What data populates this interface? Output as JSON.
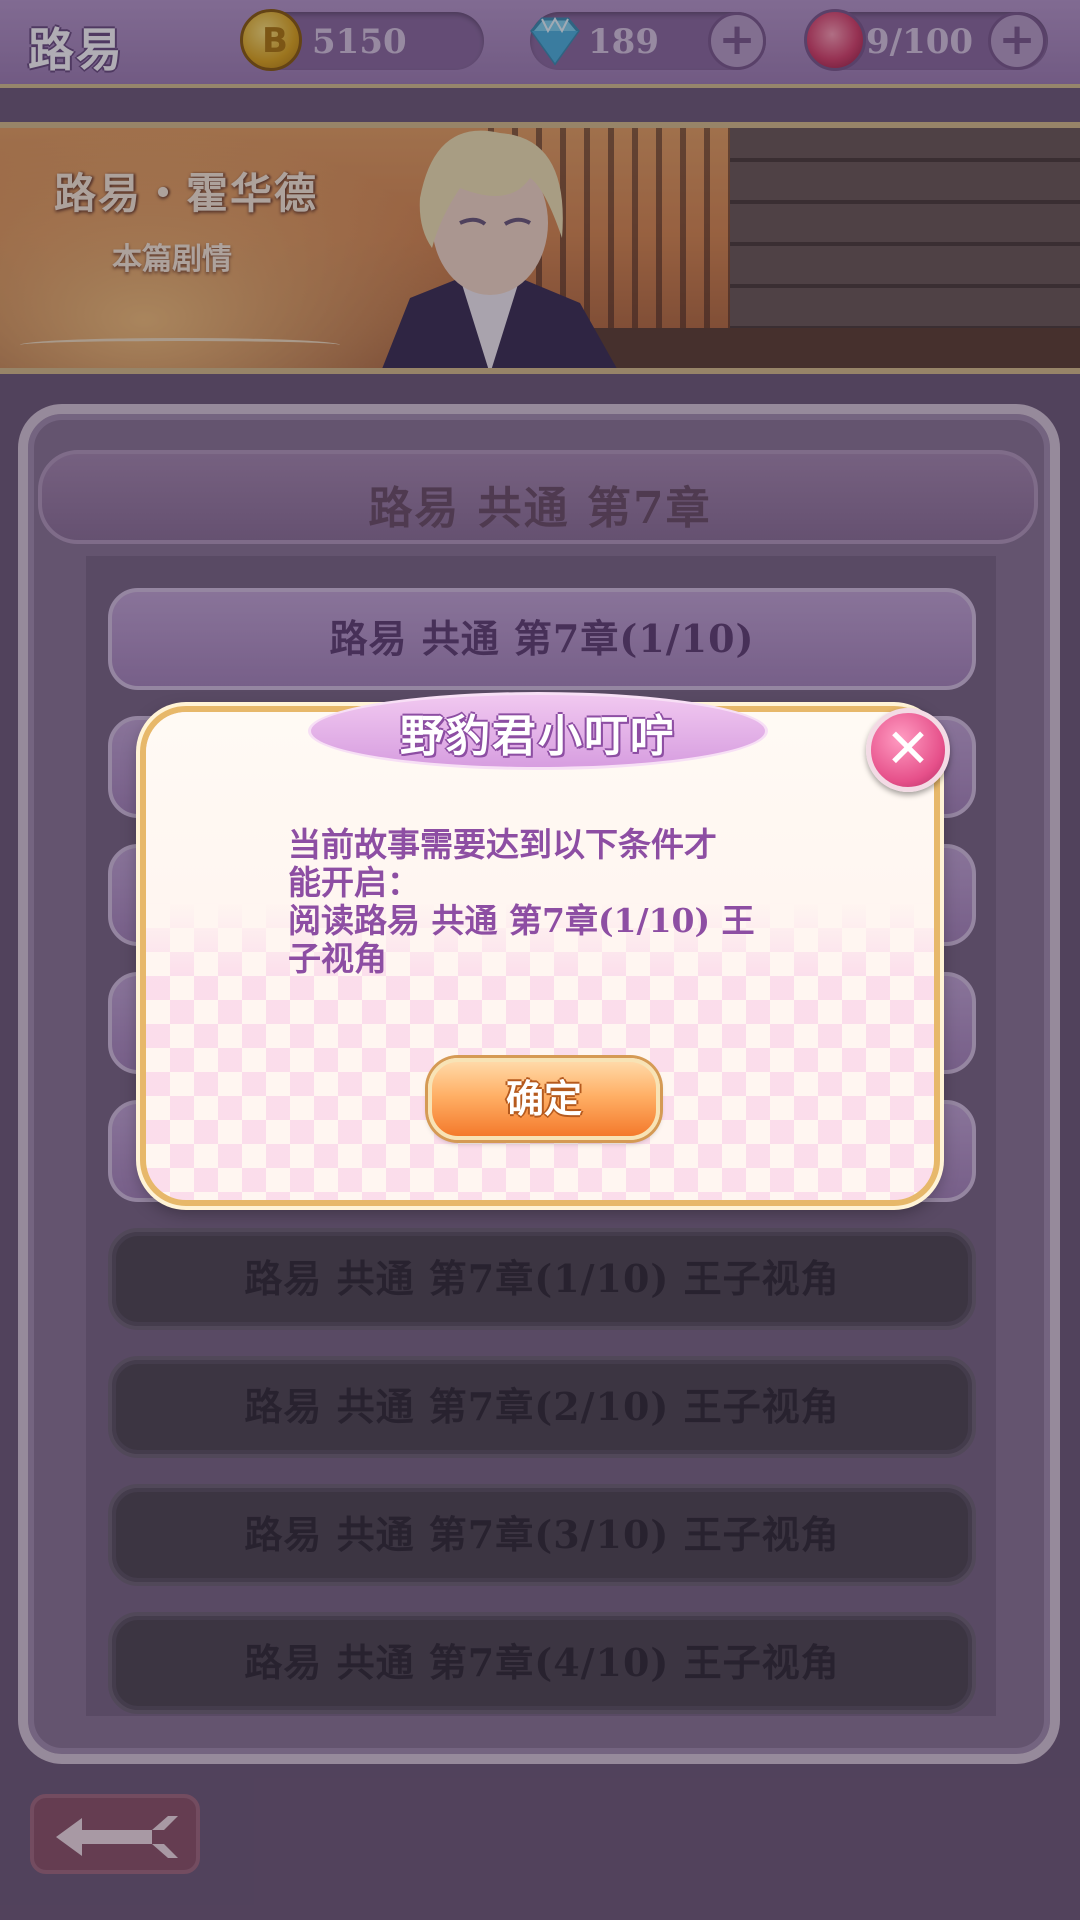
{
  "header": {
    "title": "路易",
    "coins": "5150",
    "diamonds": "189",
    "roses": "9/100",
    "icons": {
      "coin": "coin-icon",
      "diamond": "diamond-icon",
      "rose": "rose-icon",
      "plus": "plus-icon"
    }
  },
  "banner": {
    "character_name": "路易・霍华德",
    "subtitle": "本篇剧情"
  },
  "chapter": {
    "title": "路易 共通 第7章",
    "rows": [
      {
        "label": "路易 共通 第7章(1/10)",
        "state": "unlocked"
      },
      {
        "label": "路易 共通 第7章(1/10) 王子视角",
        "state": "locked"
      },
      {
        "label": "路易 共通 第7章(2/10) 王子视角",
        "state": "locked"
      },
      {
        "label": "路易 共通 第7章(3/10) 王子视角",
        "state": "locked"
      },
      {
        "label": "路易 共通 第7章(4/10) 王子视角",
        "state": "locked"
      }
    ]
  },
  "dialog": {
    "title": "野豹君小叮咛",
    "message": "当前故事需要达到以下条件才\n能开启：\n阅读路易 共通 第7章(1/10) 王\n子视角",
    "confirm_label": "确定",
    "close_icon": "close-icon"
  },
  "footer": {
    "back_icon": "back-arrow-icon"
  },
  "colors": {
    "accent_purple": "#8d4ea3",
    "confirm_orange": "#f47a2c",
    "close_pink": "#e6508a"
  }
}
